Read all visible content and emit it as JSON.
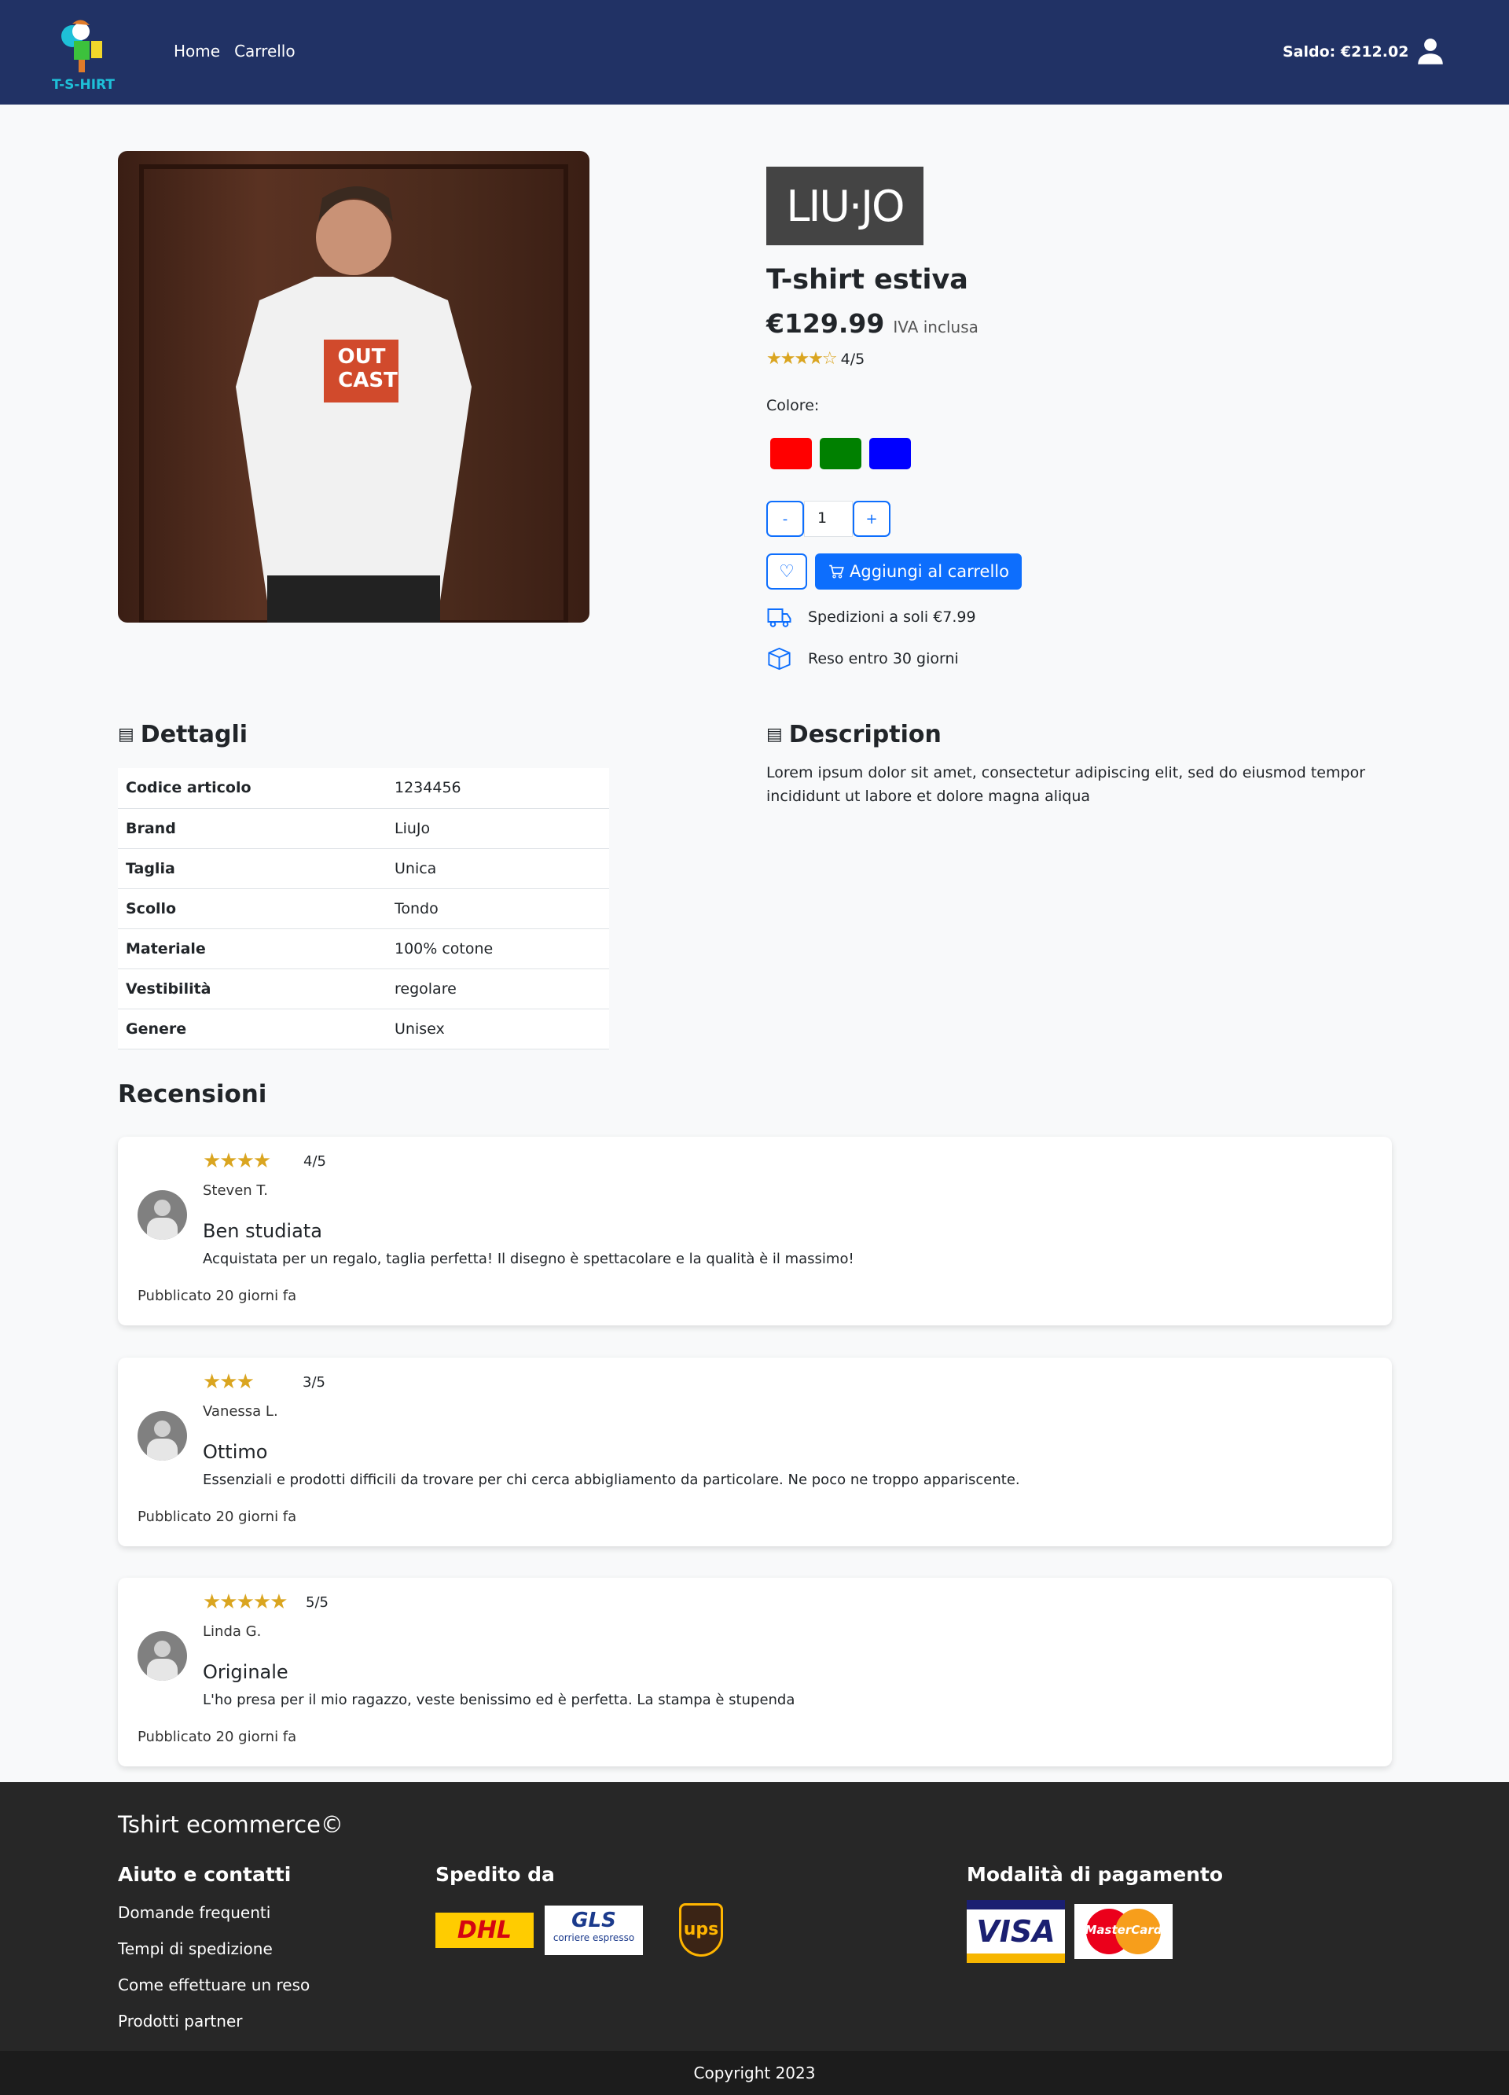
{
  "header": {
    "logo_text": "T-S-HIRT",
    "nav": [
      "Home",
      "Carrello"
    ],
    "balance": "Saldo: €212.02"
  },
  "product": {
    "brand_logo": "LIU·JO",
    "title": "T-shirt estiva",
    "price": "€129.99",
    "vat": "IVA inclusa",
    "rating": 4,
    "rating_text": "4/5",
    "color_label": "Colore:",
    "colors": [
      "#ff0000",
      "#008000",
      "#0000ff"
    ],
    "qty_minus": "-",
    "qty": "1",
    "qty_plus": "+",
    "add_to_cart": "Aggiungi al carrello",
    "shipping": "Spedizioni a soli €7.99",
    "returns": "Reso entro 30 giorni",
    "image_print": "OUT CAST"
  },
  "details": {
    "title": "Dettagli",
    "rows": [
      [
        "Codice articolo",
        "1234456"
      ],
      [
        "Brand",
        "LiuJo"
      ],
      [
        "Taglia",
        "Unica"
      ],
      [
        "Scollo",
        "Tondo"
      ],
      [
        "Materiale",
        "100% cotone"
      ],
      [
        "Vestibilità",
        "regolare"
      ],
      [
        "Genere",
        "Unisex"
      ]
    ]
  },
  "description": {
    "title": "Description",
    "text": "Lorem ipsum dolor sit amet, consectetur adipiscing elit, sed do eiusmod tempor incididunt ut labore et dolore magna aliqua"
  },
  "reviews": {
    "title": "Recensioni",
    "items": [
      {
        "stars": 4,
        "rating": "4/5",
        "author": "Steven T.",
        "title": "Ben studiata",
        "text": "Acquistata per un regalo, taglia perfetta! Il disegno è spettacolare e la qualità è il massimo!",
        "date": "Pubblicato 20 giorni fa"
      },
      {
        "stars": 3,
        "rating": "3/5",
        "author": "Vanessa L.",
        "title": "Ottimo",
        "text": "Essenziali e prodotti difficili da trovare per chi cerca abbigliamento da particolare. Ne poco ne troppo appariscente.",
        "date": "Pubblicato 20 giorni fa"
      },
      {
        "stars": 5,
        "rating": "5/5",
        "author": "Linda G.",
        "title": "Originale",
        "text": "L'ho presa per il mio ragazzo, veste benissimo ed è perfetta. La stampa è stupenda",
        "date": "Pubblicato 20 giorni fa"
      }
    ]
  },
  "footer": {
    "title": "Tshirt ecommerce©",
    "help_title": "Aiuto e contatti",
    "help_links": [
      "Domande frequenti",
      "Tempi di spedizione",
      "Come effettuare un reso",
      "Prodotti partner"
    ],
    "shipping_title": "Spedito da",
    "carriers": [
      "DHL",
      "GLS",
      "UPS"
    ],
    "gls_sub": "corriere espresso",
    "payment_title": "Modalità di pagamento",
    "payments": [
      "VISA",
      "MasterCard"
    ],
    "copyright": "Copyright 2023"
  }
}
